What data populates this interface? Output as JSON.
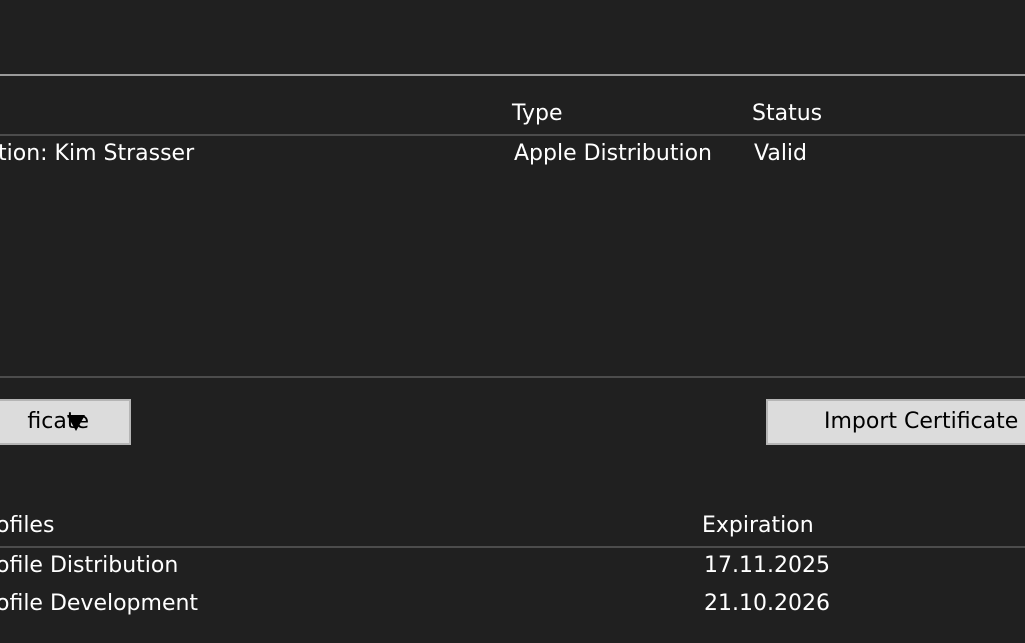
{
  "certificates": {
    "columns": {
      "type": "Type",
      "status": "Status"
    },
    "rows": [
      {
        "name": "tion: Kim Strasser",
        "type": "Apple Distribution",
        "status": "Valid"
      }
    ]
  },
  "buttons": {
    "create_label": "ficate",
    "create_arrow_icon": "triangle-down-icon",
    "import_label": "Import Certificate"
  },
  "profiles": {
    "columns": {
      "name": "ofiles",
      "expiration": "Expiration"
    },
    "rows": [
      {
        "name": "ofile Distribution",
        "expiration": "17.11.2025"
      },
      {
        "name": "ofile Development",
        "expiration": "21.10.2026"
      }
    ]
  },
  "colors": {
    "background": "#202020",
    "text": "#ffffff",
    "button_bg": "#dcdcdc",
    "button_border": "#b5b5b5",
    "divider": "#4c4c4c",
    "top_divider": "#9a9a9a"
  }
}
